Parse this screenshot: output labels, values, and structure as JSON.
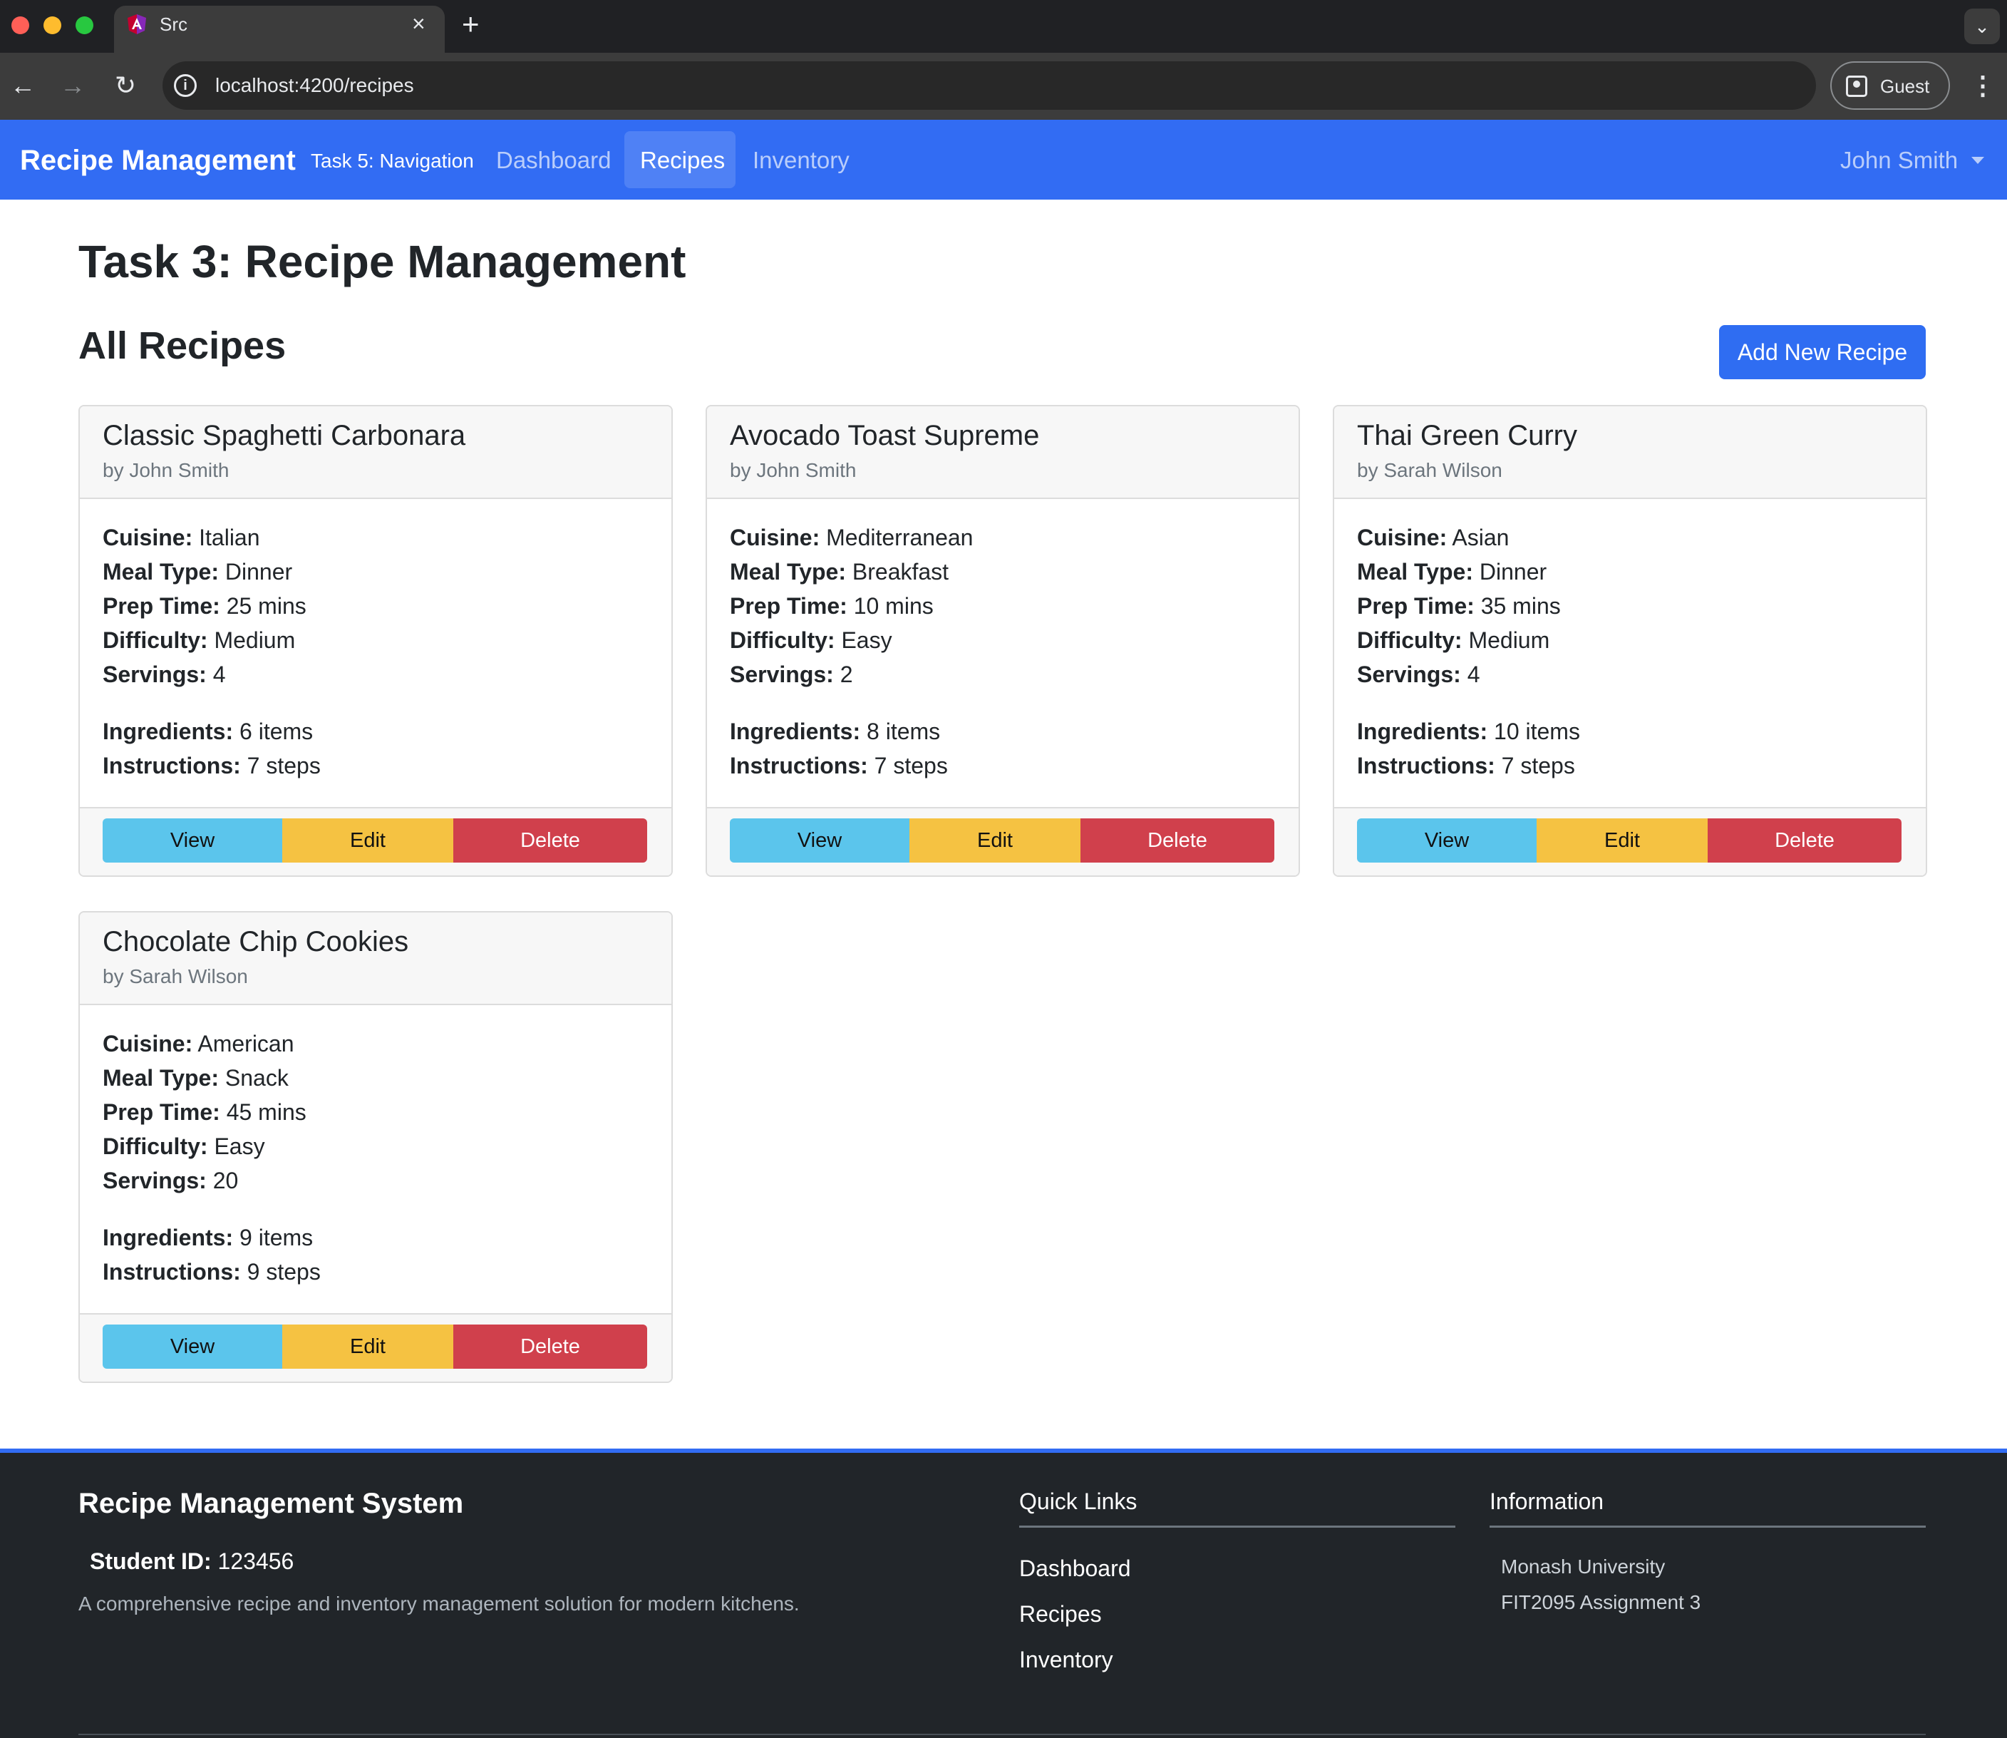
{
  "browser": {
    "tab_title": "Src",
    "url": "localhost:4200/recipes",
    "profile_label": "Guest"
  },
  "navbar": {
    "brand": "Recipe Management",
    "task_label": "Task 5: Navigation",
    "links": [
      "Dashboard",
      "Recipes",
      "Inventory"
    ],
    "active_link": "Recipes",
    "user": "John Smith",
    "color": "#326cf3"
  },
  "main": {
    "page_title": "Task 3: Recipe Management",
    "section_title": "All Recipes",
    "add_button": "Add New Recipe",
    "field_labels": {
      "cuisine": "Cuisine:",
      "meal_type": "Meal Type:",
      "prep_time": "Prep Time:",
      "difficulty": "Difficulty:",
      "servings": "Servings:",
      "ingredients": "Ingredients:",
      "instructions": "Instructions:"
    },
    "button_labels": {
      "view": "View",
      "edit": "Edit",
      "delete": "Delete"
    },
    "recipes": [
      {
        "title": "Classic Spaghetti Carbonara",
        "author": "by John Smith",
        "cuisine": "Italian",
        "meal_type": "Dinner",
        "prep_time": "25 mins",
        "difficulty": "Medium",
        "servings": "4",
        "ingredients": "6 items",
        "instructions": "7 steps"
      },
      {
        "title": "Avocado Toast Supreme",
        "author": "by John Smith",
        "cuisine": "Mediterranean",
        "meal_type": "Breakfast",
        "prep_time": "10 mins",
        "difficulty": "Easy",
        "servings": "2",
        "ingredients": "8 items",
        "instructions": "7 steps"
      },
      {
        "title": "Thai Green Curry",
        "author": "by Sarah Wilson",
        "cuisine": "Asian",
        "meal_type": "Dinner",
        "prep_time": "35 mins",
        "difficulty": "Medium",
        "servings": "4",
        "ingredients": "10 items",
        "instructions": "7 steps"
      },
      {
        "title": "Chocolate Chip Cookies",
        "author": "by Sarah Wilson",
        "cuisine": "American",
        "meal_type": "Snack",
        "prep_time": "45 mins",
        "difficulty": "Easy",
        "servings": "20",
        "ingredients": "9 items",
        "instructions": "9 steps"
      }
    ]
  },
  "footer": {
    "brand": "Recipe Management System",
    "student_label": "Student ID:",
    "student_id": "123456",
    "description": "A comprehensive recipe and inventory management solution for modern kitchens.",
    "quick_links_title": "Quick Links",
    "quick_links": [
      "Dashboard",
      "Recipes",
      "Inventory"
    ],
    "info_title": "Information",
    "info_lines": [
      "Monash University",
      "FIT2095 Assignment 3"
    ]
  }
}
